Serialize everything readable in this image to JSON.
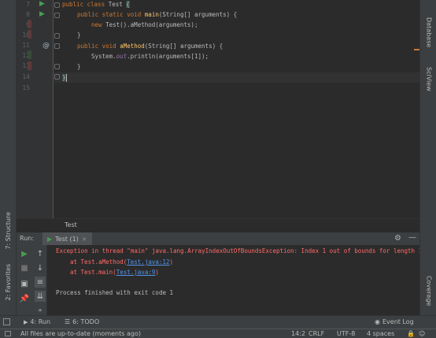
{
  "editor": {
    "lines": [
      {
        "num": "7"
      },
      {
        "num": "8"
      },
      {
        "num": "9"
      },
      {
        "num": "10"
      },
      {
        "num": "11"
      },
      {
        "num": "12"
      },
      {
        "num": "13"
      },
      {
        "num": "14"
      },
      {
        "num": "15"
      }
    ],
    "code": {
      "l7_kw": "public class ",
      "l7_name": "Test ",
      "l7_brace": "{",
      "l8_kw": "public static void ",
      "l8_fn": "main",
      "l8_rest": "(String[] arguments) {",
      "l9_kw": "new ",
      "l9_rest": "Test().aMethod(arguments);",
      "l10": "}",
      "l12_kw": "public void ",
      "l12_fn": "aMethod",
      "l12_rest": "(String[] arguments) {",
      "l13_a": "System.",
      "l13_it": "out",
      "l13_b": ".println(arguments[1]);",
      "l14": "}",
      "l15": "}"
    },
    "gutter_override_mark": "@"
  },
  "breadcrumb": "Test",
  "run_panel": {
    "label": "Run:",
    "tab_label": "Test (1)",
    "tab_close": "×",
    "console": {
      "line1": "Exception in thread \"main\" java.lang.ArrayIndexOutOfBoundsException: Index 1 out of bounds for length 1",
      "line2_prefix": "at Test.aMethod(",
      "line2_link": "Test.java:12",
      "line2_suffix": ")",
      "line3_prefix": "at Test.main(",
      "line3_link": "Test.java:9",
      "line3_suffix": ")",
      "line4": "Process finished with exit code 1"
    }
  },
  "left_tabs": {
    "structure": "7: Structure",
    "favorites": "2: Favorites"
  },
  "right_tabs": {
    "database": "Database",
    "sciview": "SciView",
    "coverage": "Coverage"
  },
  "tool_bar": {
    "run": "4: Run",
    "todo": "6: TODO",
    "event_log": "Event Log"
  },
  "status_bar": {
    "message": "All files are up-to-date (moments ago)",
    "position": "14:2",
    "line_sep": "CRLF",
    "encoding": "UTF-8",
    "indent": "4 spaces"
  },
  "colors": {
    "background": "#2b2b2b",
    "panel": "#3c3f41",
    "error": "#ff6b68",
    "link": "#5394ec",
    "keyword": "#cc7832",
    "function": "#ffc66d",
    "run_green": "#499c54"
  }
}
